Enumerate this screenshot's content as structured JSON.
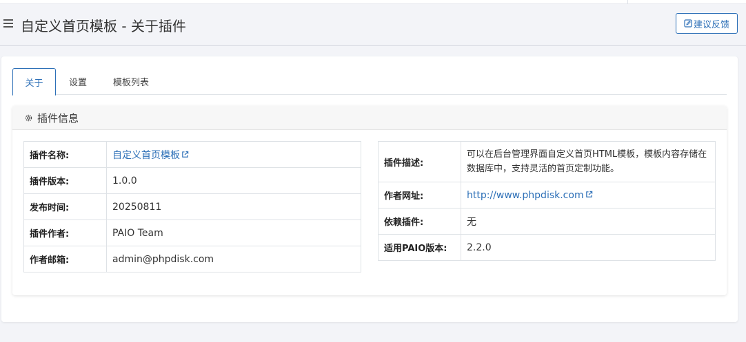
{
  "header": {
    "title": "自定义首页模板 - 关于插件",
    "feedback_button": "建议反馈"
  },
  "tabs": [
    {
      "label": "关于",
      "active": true
    },
    {
      "label": "设置",
      "active": false
    },
    {
      "label": "模板列表",
      "active": false
    }
  ],
  "card": {
    "title": "插件信息",
    "title_icon": "gear-icon"
  },
  "left_table": [
    {
      "key": "插件名称:",
      "value": "自定义首页模板",
      "link": true
    },
    {
      "key": "插件版本:",
      "value": "1.0.0"
    },
    {
      "key": "发布时间:",
      "value": "20250811"
    },
    {
      "key": "插件作者:",
      "value": "PAIO Team"
    },
    {
      "key": "作者邮箱:",
      "value": "admin@phpdisk.com"
    }
  ],
  "right_table": [
    {
      "key": "插件描述:",
      "value": "可以在后台管理界面自定义首页HTML模板，模板内容存储在数据库中，支持灵活的首页定制功能。"
    },
    {
      "key": "作者网址:",
      "value": "http://www.phpdisk.com",
      "link": true
    },
    {
      "key": "依赖插件:",
      "value": "无"
    },
    {
      "key": "适用PAIO版本:",
      "value": "2.2.0"
    }
  ],
  "colors": {
    "accent": "#2c6fb7",
    "background": "#f3f4f8"
  }
}
